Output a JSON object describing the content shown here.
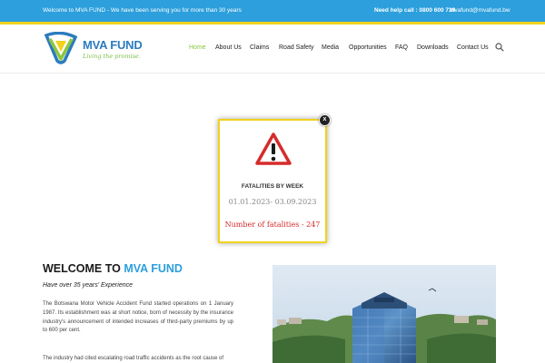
{
  "topbar": {
    "welcome": "Welcome to MVA FUND - We have been serving you for more than 30 years",
    "help": "Need help call : 0800 600 739",
    "email": "mvafund@mvafund.bw"
  },
  "logo": {
    "brand": "MVA FUND",
    "tagline": "Living the promise."
  },
  "nav": {
    "items": [
      "Home",
      "About Us",
      "Claims",
      "Road Safety",
      "Media",
      "Opportunities",
      "FAQ",
      "Downloads",
      "Contact Us"
    ],
    "active": "Home"
  },
  "popup": {
    "title": "FATALITIES BY WEEK",
    "dates": "01.01.2023- 03.09.2023",
    "count": "Number of fatalities - 247",
    "close": "x"
  },
  "welcome": {
    "title_prefix": "WELCOME TO ",
    "title_accent": "MVA FUND",
    "subtitle": "Have over 35 years' Experience",
    "para1": "The Botswana Motor Vehicle Accident Fund started operations on 1 January 1987. Its establishment was at short notice, born of necessity by the insurance industry's announcement of intended increases of third-party premiums by up to 600 per cent.",
    "para2": "The industry had cited escalating road traffic accidents as the root cause of"
  },
  "colors": {
    "topbar": "#2c9fdc",
    "accent_yellow": "#f2d21c",
    "nav_active": "#8cc63f",
    "brand_blue": "#2b7bbf",
    "fatalities_red": "#d62b2b"
  }
}
